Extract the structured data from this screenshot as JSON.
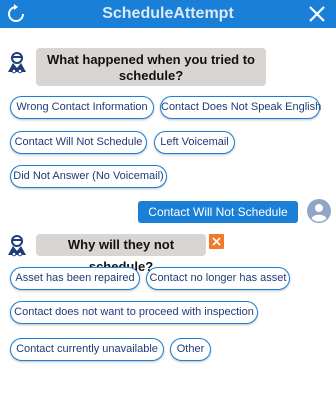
{
  "header": {
    "title": "ScheduleAttempt",
    "refresh_icon": "refresh-icon",
    "close_icon": "close-icon",
    "color": "#1a7fd6"
  },
  "bot_messages": [
    {
      "text": "What happened when you tried to schedule?"
    },
    {
      "text": "Why will they not schedule?"
    }
  ],
  "options_1": [
    "Wrong Contact Information",
    "Contact Does Not Speak English",
    "Contact Will Not Schedule",
    "Left Voicemail",
    "Did Not Answer (No Voicemail)"
  ],
  "user_reply": "Contact Will Not Schedule",
  "options_2": [
    "Asset has been repaired",
    "Contact no longer has asset",
    "Contact does not want to proceed with inspection",
    "Contact currently unavailable",
    "Other"
  ]
}
